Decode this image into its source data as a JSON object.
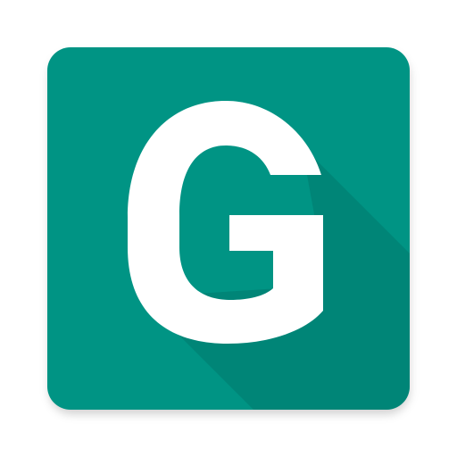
{
  "app_icon": {
    "letter": "G",
    "colors": {
      "tile": "#009484",
      "long_shadow": "#00796d",
      "letter": "#ffffff",
      "background": "#ffffff"
    }
  }
}
